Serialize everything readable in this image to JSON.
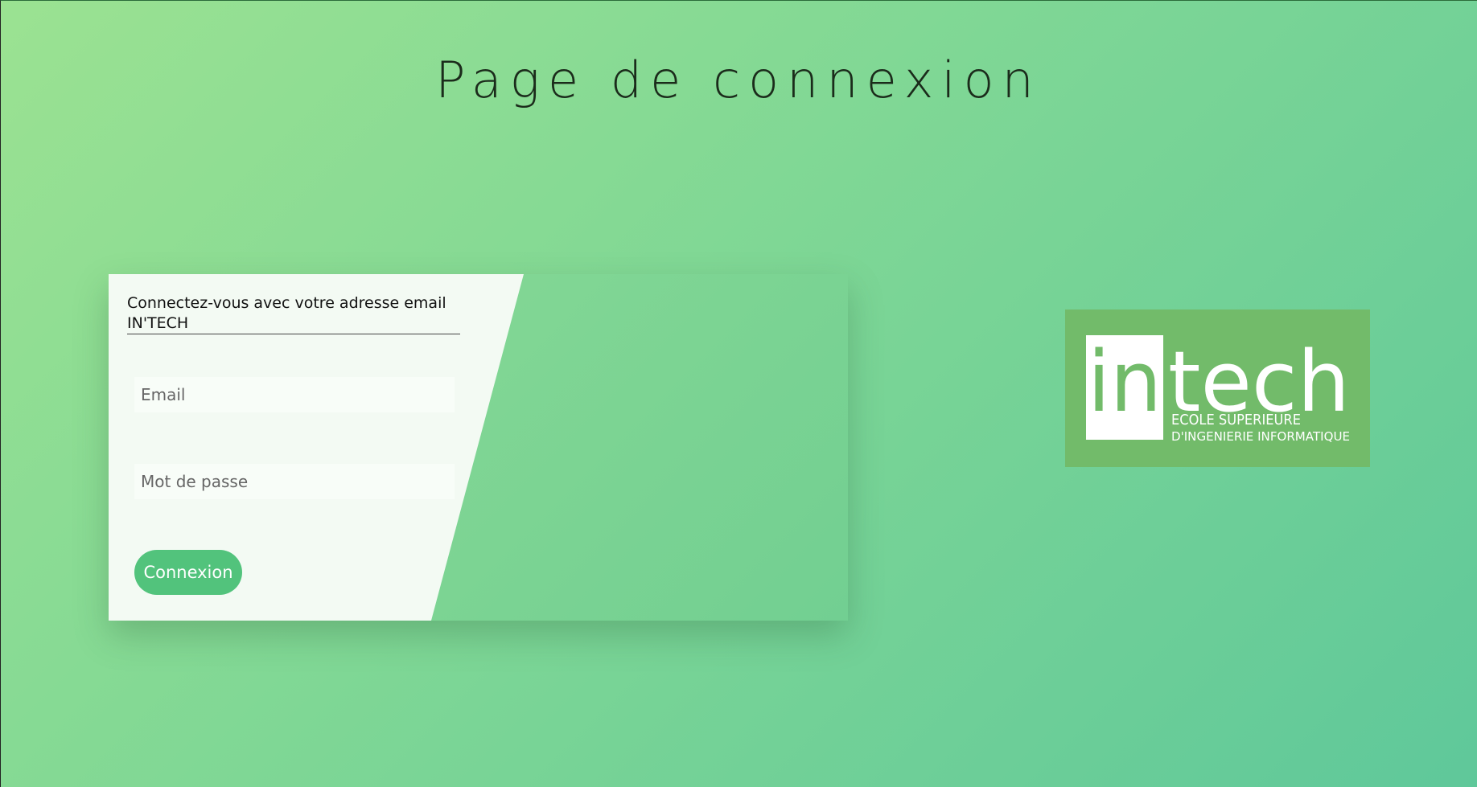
{
  "page": {
    "title": "Page de connexion"
  },
  "login": {
    "heading_line1": "Connectez-vous avec votre adresse email",
    "heading_line2": "IN'TECH",
    "email_placeholder": "Email",
    "password_placeholder": "Mot de passe",
    "submit_label": "Connexion"
  },
  "logo": {
    "wordmark_in": "in",
    "wordmark_tech": "tech",
    "tagline_line1": "ECOLE SUPERIEURE",
    "tagline_line2": "D'INGENIERIE INFORMATIQUE"
  },
  "colors": {
    "background_start": "#9be292",
    "background_end": "#5fc89a",
    "card_panel": "#f3faf3",
    "button": "#52c37c",
    "logo_background": "#72bb6a"
  }
}
